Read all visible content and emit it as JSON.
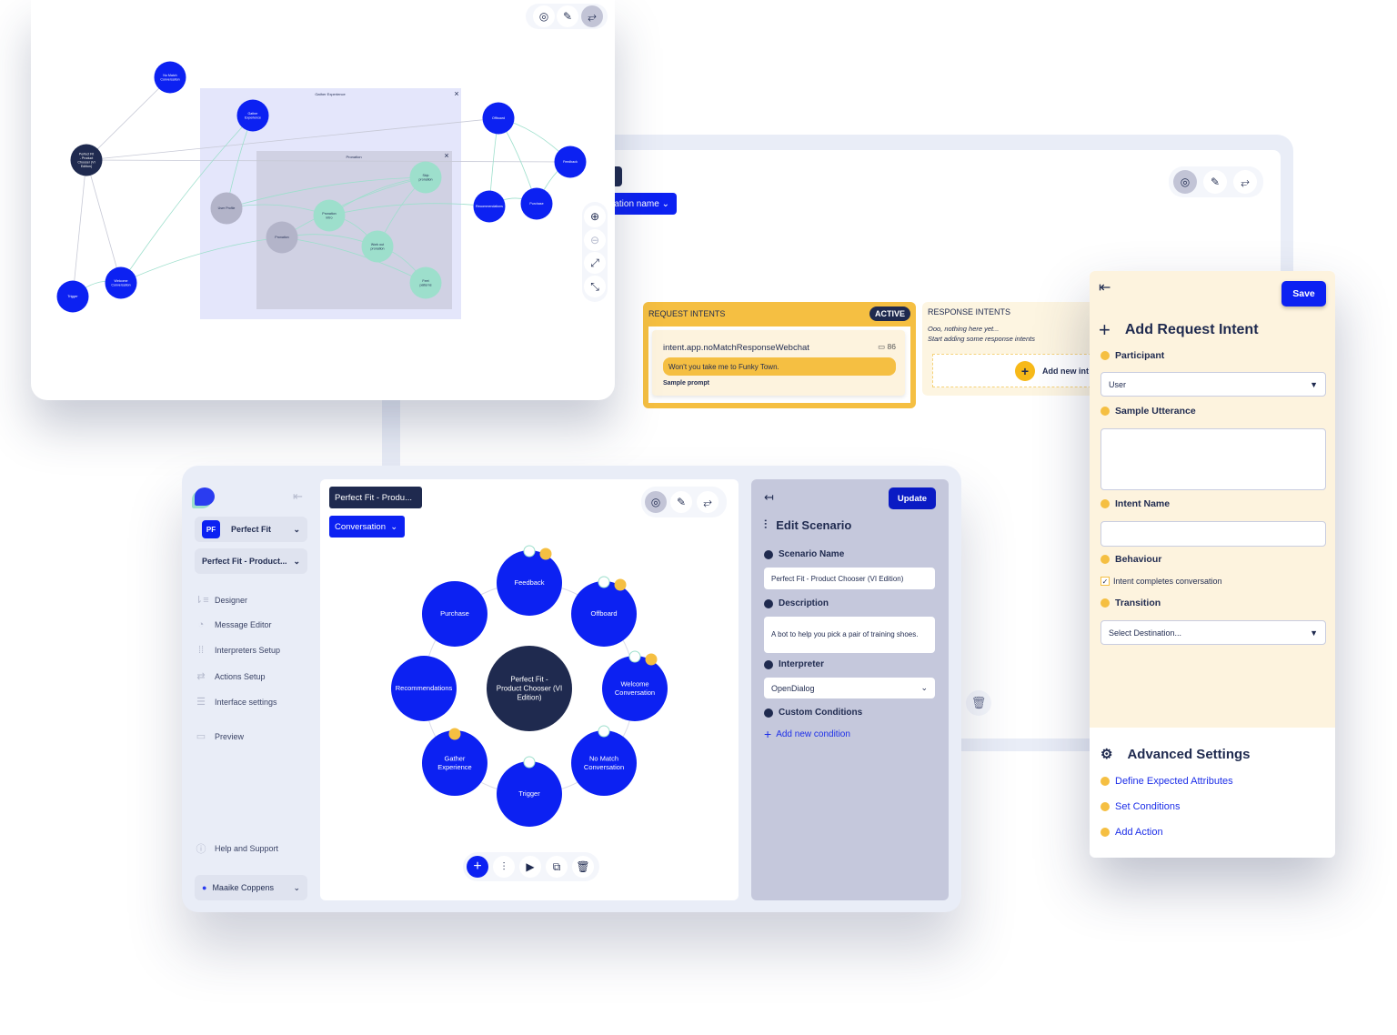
{
  "colors": {
    "brand_blue": "#0c21f2",
    "navy": "#1f2a4f",
    "teal": "#9ddfcc",
    "gray_node": "#b3b4c9",
    "yellow": "#f5bf42",
    "cream": "#fdf3de"
  },
  "top_window": {
    "groups": [
      {
        "id": "gather",
        "label": "Gather Experience"
      },
      {
        "id": "promo",
        "label": "Pronation"
      }
    ],
    "nodes": [
      {
        "id": "nomatch",
        "label": "No Match Conversation",
        "kind": "blue"
      },
      {
        "id": "gather",
        "label": "Gather Experience",
        "kind": "blue"
      },
      {
        "id": "pf",
        "label": "Perfect Fit - Product Chooser (VI Edition)",
        "kind": "navy"
      },
      {
        "id": "offboard",
        "label": "Offboard",
        "kind": "blue"
      },
      {
        "id": "feedback",
        "label": "Feedback",
        "kind": "blue"
      },
      {
        "id": "reco",
        "label": "Recommendations",
        "kind": "blue"
      },
      {
        "id": "purchase",
        "label": "Purchase",
        "kind": "blue"
      },
      {
        "id": "userprofile",
        "label": "User Profile",
        "kind": "gray"
      },
      {
        "id": "pronation",
        "label": "Pronation",
        "kind": "gray"
      },
      {
        "id": "pronintro",
        "label": "Pronation intro",
        "kind": "teal"
      },
      {
        "id": "skip",
        "label": "Skip pronation",
        "kind": "teal"
      },
      {
        "id": "workout",
        "label": "Work out pronation",
        "kind": "teal"
      },
      {
        "id": "feet",
        "label": "Feet patterns",
        "kind": "teal"
      },
      {
        "id": "trigger",
        "label": "Trigger",
        "kind": "blue"
      },
      {
        "id": "welcome",
        "label": "Welcome Conversation",
        "kind": "blue"
      }
    ],
    "edges": [
      [
        "pf",
        "nomatch"
      ],
      [
        "pf",
        "offboard"
      ],
      [
        "pf",
        "feedback"
      ],
      [
        "pf",
        "trigger"
      ],
      [
        "pf",
        "welcome"
      ],
      [
        "userprofile",
        "gather"
      ],
      [
        "welcome",
        "gather"
      ],
      [
        "welcome",
        "pronation"
      ],
      [
        "userprofile",
        "pronintro"
      ],
      [
        "pronation",
        "skip"
      ],
      [
        "pronation",
        "workout"
      ],
      [
        "pronation",
        "feet"
      ],
      [
        "pronintro",
        "skip"
      ],
      [
        "pronintro",
        "workout"
      ],
      [
        "workout",
        "feet"
      ],
      [
        "workout",
        "skip"
      ],
      [
        "pronintro",
        "reco"
      ],
      [
        "skip",
        "userprofile"
      ],
      [
        "reco",
        "offboard"
      ],
      [
        "purchase",
        "offboard"
      ],
      [
        "purchase",
        "feedback"
      ],
      [
        "reco",
        "purchase"
      ],
      [
        "feedback",
        "offboard"
      ],
      [
        "trigger",
        "welcome"
      ]
    ],
    "toolbar_icons": [
      "scenario-icon",
      "message-icon",
      "flow-icon"
    ],
    "zoom_icons": [
      "zoom-in-icon",
      "zoom-out-icon",
      "expand-icon",
      "collapse-icon"
    ]
  },
  "back_window": {
    "dropdown_label": "ation name",
    "request_intents": {
      "title": "REQUEST INTENTS",
      "badge": "ACTIVE",
      "intent_name": "intent.app.noMatchResponseWebchat",
      "count": "86",
      "prompt": "Won't you take me to Funky Town.",
      "prompt_label": "Sample prompt"
    },
    "response_intents": {
      "title": "RESPONSE INTENTS",
      "empty_line1": "Ooo, nothing here yet...",
      "empty_line2": "Start adding some response intents",
      "add_label": "Add new int"
    }
  },
  "sidebar": {
    "workspace": {
      "initials": "PF",
      "name": "Perfect Fit"
    },
    "scenario": "Perfect Fit - Product...",
    "items": [
      {
        "label": "Designer",
        "icon": "designer-icon"
      },
      {
        "label": "Message Editor",
        "icon": "message-editor-icon"
      },
      {
        "label": "Interpreters Setup",
        "icon": "interpreters-icon"
      },
      {
        "label": "Actions Setup",
        "icon": "actions-icon"
      },
      {
        "label": "Interface settings",
        "icon": "sliders-icon"
      },
      {
        "label": "Preview",
        "icon": "preview-icon"
      }
    ],
    "help": "Help and Support",
    "user": "Maaike Coppens"
  },
  "canvas": {
    "scenario_chip": "Perfect Fit - Produ...",
    "dropdown": "Conversation",
    "center": "Perfect Fit - Product Chooser (VI Edition)",
    "nodes": [
      {
        "label": "Feedback",
        "pin": true,
        "badge": true
      },
      {
        "label": "Offboard",
        "pin": true,
        "badge": true
      },
      {
        "label": "Welcome Conversation",
        "pin": true,
        "badge": true
      },
      {
        "label": "No Match Conversation",
        "pin": true,
        "badge": false
      },
      {
        "label": "Trigger",
        "pin": true,
        "badge": false
      },
      {
        "label": "Gather Experience",
        "pin": false,
        "badge": true
      },
      {
        "label": "Recommendations",
        "pin": false,
        "badge": false
      },
      {
        "label": "Purchase",
        "pin": false,
        "badge": false
      }
    ]
  },
  "edit_scenario": {
    "update": "Update",
    "title": "Edit Scenario",
    "name_label": "Scenario Name",
    "name_value": "Perfect Fit - Product Chooser (VI Edition)",
    "desc_label": "Description",
    "desc_value": "A bot to help you pick a pair of training shoes.",
    "interp_label": "Interpreter",
    "interp_value": "OpenDialog",
    "cond_label": "Custom Conditions",
    "add_condition": "Add new condition"
  },
  "request_intent_panel": {
    "save": "Save",
    "title": "Add Request Intent",
    "participant_label": "Participant",
    "participant_value": "User",
    "utterance_label": "Sample Utterance",
    "utterance_value": "",
    "intent_name_label": "Intent Name",
    "intent_name_value": "",
    "behaviour_label": "Behaviour",
    "checkbox_label": "Intent completes conversation",
    "checkbox_checked": true,
    "transition_label": "Transition",
    "transition_placeholder": "Select Destination...",
    "advanced_title": "Advanced Settings",
    "advanced_links": [
      "Define Expected Attributes",
      "Set Conditions",
      "Add Action"
    ]
  }
}
